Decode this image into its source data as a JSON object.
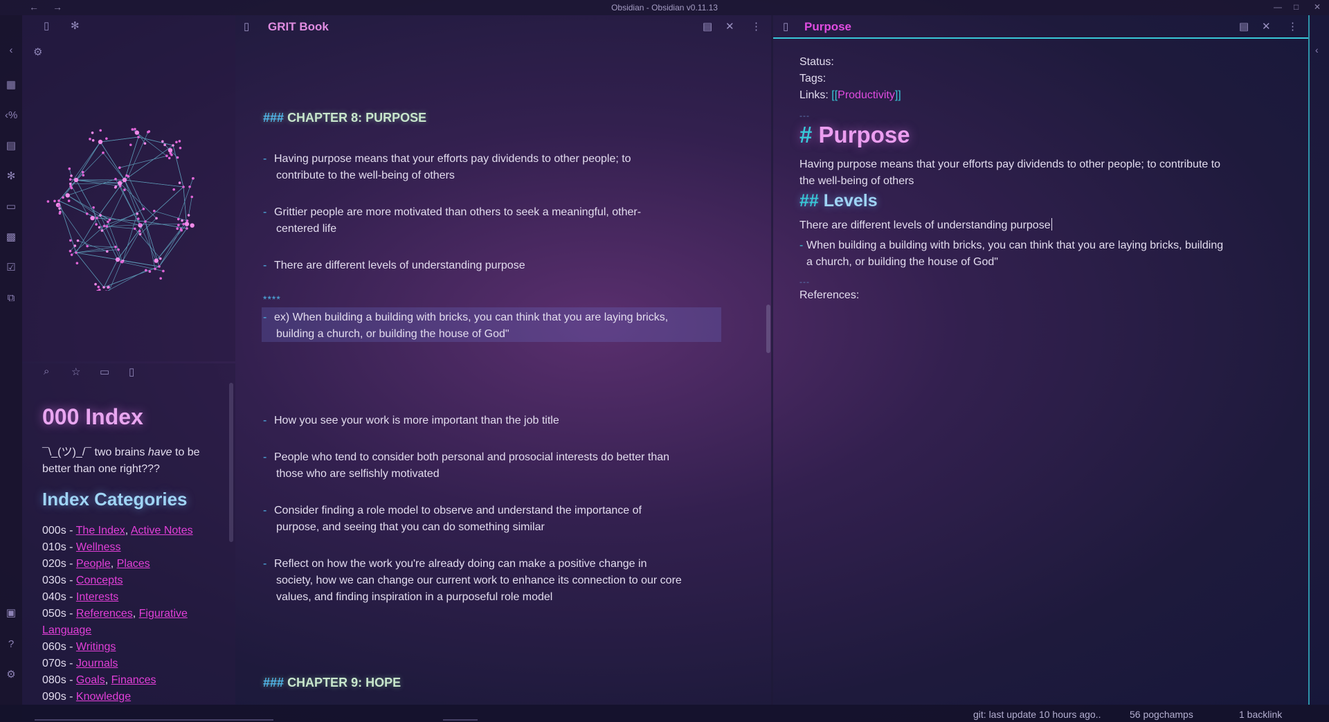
{
  "window": {
    "title": "Obsidian - Obsidian v0.11.13"
  },
  "status_bar": {
    "git": "git: last update 10 hours ago..",
    "words": "56 pogchamps",
    "backlinks": "1 backlink"
  },
  "left_sidebar": {
    "index_title": "000 Index",
    "intro_prefix": "¯\\_(ツ)_/¯ two brains ",
    "intro_em": "have",
    "intro_suffix": " to be better than one right???",
    "categories_title": "Index Categories",
    "categories": [
      {
        "code": "000s",
        "links": [
          "The Index",
          "Active Notes"
        ]
      },
      {
        "code": "010s",
        "links": [
          "Wellness"
        ]
      },
      {
        "code": "020s",
        "links": [
          "People",
          "Places"
        ]
      },
      {
        "code": "030s",
        "links": [
          "Concepts"
        ]
      },
      {
        "code": "040s",
        "links": [
          "Interests"
        ]
      },
      {
        "code": "050s",
        "links": [
          "References",
          "Figurative Language"
        ]
      },
      {
        "code": "060s",
        "links": [
          "Writings"
        ]
      },
      {
        "code": "070s",
        "links": [
          "Journals"
        ]
      },
      {
        "code": "080s",
        "links": [
          "Goals",
          "Finances"
        ]
      },
      {
        "code": "090s",
        "links": [
          "Knowledge"
        ]
      }
    ]
  },
  "middle_pane": {
    "title": "GRIT Book",
    "heading1_hash": "###",
    "heading1_text": "CHAPTER 8: PURPOSE",
    "bullets_a": [
      {
        "l1": "Having purpose means that your efforts pay dividends to other people; to",
        "l2": "contribute to the well-being of others"
      },
      {
        "l1": "Grittier people are more motivated than others to seek a meaningful, other-",
        "l2": "centered life"
      },
      {
        "l1": "There are different levels of understanding purpose",
        "l2": ""
      }
    ],
    "stars": "****",
    "highlight_bullet": {
      "l1": "ex) When building a building with bricks, you can think that you are laying bricks,",
      "l2": "building a church, or building the house of God\""
    },
    "bullets_b": [
      {
        "l1": "How you see your work is more important than the job title",
        "l2": ""
      },
      {
        "l1": "People who tend to consider both personal and prosocial interests do better than",
        "l2": "those who are selfishly motivated"
      },
      {
        "l1": "Consider finding a role model to observe and understand the importance of",
        "l2": "purpose, and seeing that you can do something similar"
      },
      {
        "l1": "Reflect on how the work you're already doing can make a positive change in",
        "l2": "society, how we can change our current work to enhance its connection to our core",
        "l3": "values, and finding inspiration in a purposeful role model"
      }
    ],
    "heading2_hash": "###",
    "heading2_text": "CHAPTER 9: HOPE",
    "dash": "-"
  },
  "right_pane": {
    "title": "Purpose",
    "status_label": "Status:",
    "tags_label": "Tags:",
    "links_label": "Links:",
    "link_open": "[[",
    "link_text": "Productivity",
    "link_close": "]]",
    "hr": "---",
    "h1_hash": "#",
    "h1_text": "Purpose",
    "para1_l1": "Having purpose means that your efforts pay dividends to other people; to contribute to",
    "para1_l2": "the well-being of others",
    "h2_hash": "##",
    "h2_text": "Levels",
    "para2": "There are different levels of understanding purpose",
    "bullet_l1": "When building a building with bricks, you can think that you are laying bricks, building",
    "bullet_l2": "a church, or building the house of God\"",
    "references_label": "References:"
  },
  "colors": {
    "accent_cyan": "#38c8d8",
    "accent_pink": "#e04ce0",
    "link": "#e23fd8"
  }
}
